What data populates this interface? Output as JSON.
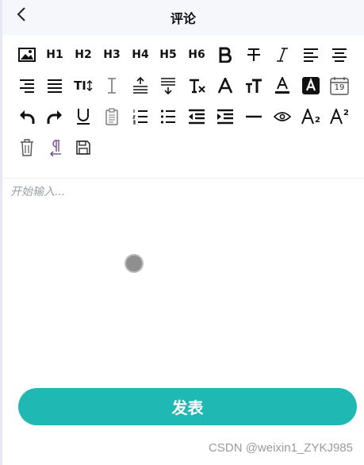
{
  "navbar": {
    "title": "评论",
    "back_icon": "chevron-left-icon"
  },
  "toolbar": {
    "heading_labels": [
      "H1",
      "H2",
      "H3",
      "H4",
      "H5",
      "H6"
    ],
    "font_size_label": "TI",
    "icons": [
      "image-icon",
      "bold-icon",
      "strikethrough-icon",
      "italic-icon",
      "align-left-icon",
      "align-center-icon",
      "align-right-icon",
      "align-justify-icon",
      "font-size-icon",
      "line-height-icon",
      "paragraph-spacing-above-icon",
      "paragraph-spacing-below-icon",
      "clear-format-icon",
      "font-family-icon",
      "font-size-increase-icon",
      "text-color-icon",
      "background-color-icon",
      "date-icon",
      "undo-icon",
      "redo-icon",
      "underline-icon",
      "clipboard-icon",
      "ordered-list-icon",
      "bullet-list-icon",
      "outdent-icon",
      "indent-icon",
      "horizontal-rule-icon",
      "preview-icon",
      "subscript-icon",
      "superscript-icon",
      "delete-icon",
      "paragraph-direction-icon",
      "save-icon"
    ],
    "calendar_day": "19",
    "subscript_digit": "2",
    "superscript_digit": "2"
  },
  "editor": {
    "placeholder": "开始输入..."
  },
  "submit": {
    "label": "发表"
  },
  "watermark": "CSDN @weixin1_ZYKJ985"
}
